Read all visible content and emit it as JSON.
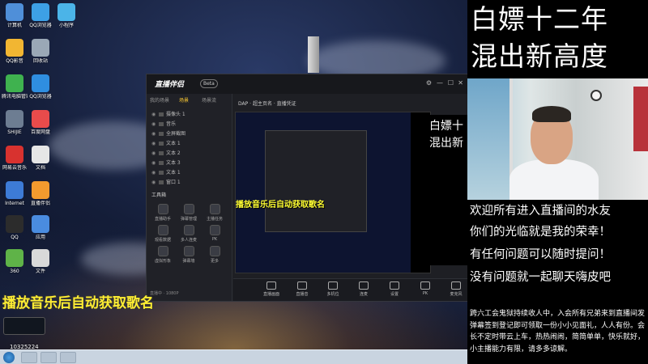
{
  "banner": {
    "line1": "白嫖十二年",
    "line2": "混出新高度"
  },
  "info": {
    "line1": "欢迎所有进入直播间的水友",
    "line2": "你们的光临就是我的荣幸！",
    "line3": "有任何问题可以随时提问！",
    "line4": "没有问题就一起聊天嗨皮吧",
    "small": "跨六工会鬼狱持续收人中，入会所有兄弟来到直播间发弹幕签到登记即可领取一份小小见面礼，人人有份。会长不定时带云上车，热热闹闹，简简单单，快乐就好，小主播能力有限，请多多谅解。"
  },
  "caption": "播放音乐后自动获取歌名",
  "app": {
    "brand": "直播伴侣",
    "badge": "Beta",
    "tabs": [
      "我的场景",
      "场景",
      "场景流"
    ],
    "scenes": [
      "摄像头 1",
      "音乐",
      "全屏截图",
      "文本 1",
      "文本 2",
      "文本 3",
      "文本 1",
      "窗口 1"
    ],
    "toolbox_title": "工具箱",
    "tools": [
      "直播助手",
      "弹幕管理",
      "主播任务",
      "观看数据",
      "多人连麦",
      "PK",
      "虚拟形象",
      "弹幕墙",
      "更多"
    ],
    "main_top": "DAP · 超主页名 · 直播凭证",
    "preview_caption": "播放音乐后自动获取歌名",
    "overlay_l1": "白嫖十",
    "overlay_l2": "混出新",
    "bottom_buttons": [
      "直播画面",
      "直播音",
      "多机位",
      "连麦",
      "设置",
      "PK",
      "麦克风"
    ],
    "status": "直播中 · 1080P"
  },
  "corner": {
    "id": "10325224"
  },
  "desktop_icons": [
    {
      "label": "计算机",
      "color": "#4f8fd9"
    },
    {
      "label": "QQ浏览器",
      "color": "#3da0e6"
    },
    {
      "label": "小程序",
      "color": "#4bb4e8"
    },
    {
      "label": "QQ影音",
      "color": "#f2b632"
    },
    {
      "label": "回收站",
      "color": "#9aa8b6"
    },
    {
      "label": "腾讯电脑管家",
      "color": "#3fb24f"
    },
    {
      "label": "QQ浏览器",
      "color": "#2f8ee0"
    },
    {
      "label": "SHIJIE",
      "color": "#6d7d92"
    },
    {
      "label": "百度网盘",
      "color": "#e84b4b"
    },
    {
      "label": "网易云音乐",
      "color": "#d8322f"
    },
    {
      "label": "文档",
      "color": "#e6e6e6"
    },
    {
      "label": "Internet",
      "color": "#3d7bd6"
    },
    {
      "label": "直播伴侣",
      "color": "#f29a2e"
    },
    {
      "label": "QQ",
      "color": "#2c2c2c"
    },
    {
      "label": "应用",
      "color": "#4a8ce0"
    },
    {
      "label": "360",
      "color": "#5fb348"
    },
    {
      "label": "文件",
      "color": "#d9d9d9"
    }
  ]
}
